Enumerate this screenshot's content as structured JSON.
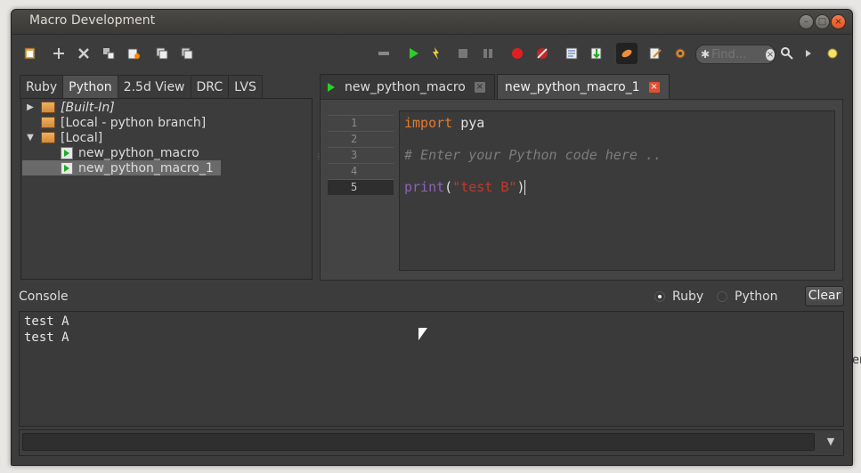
{
  "window": {
    "title": "Macro Development"
  },
  "toolbar": {
    "find_placeholder": "Find..."
  },
  "left_tabs": [
    "Ruby",
    "Python",
    "2.5d View",
    "DRC",
    "LVS"
  ],
  "tree": {
    "items": [
      {
        "label": "[Built-In]"
      },
      {
        "label": "[Local - python branch]"
      },
      {
        "label": "[Local]"
      },
      {
        "label": "new_python_macro"
      },
      {
        "label": "new_python_macro_1"
      }
    ]
  },
  "editor_tabs": [
    {
      "label": "new_python_macro"
    },
    {
      "label": "new_python_macro_1"
    }
  ],
  "editor": {
    "line_numbers": [
      "1",
      "2",
      "3",
      "4",
      "5"
    ],
    "code": {
      "l1_kw": "import",
      "l1_id": " pya",
      "l3_comment": "# Enter your Python code here ..",
      "l5_fn": "print",
      "l5_open": "(",
      "l5_str": "\"test B\"",
      "l5_close": ")"
    }
  },
  "console": {
    "label": "Console",
    "radio_ruby": "Ruby",
    "radio_python": "Python",
    "clear": "Clear",
    "output": [
      "test A",
      "test A"
    ]
  },
  "offscreen_text": "er"
}
